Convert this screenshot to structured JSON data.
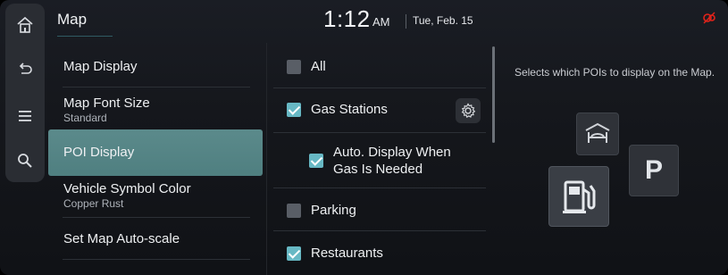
{
  "header": {
    "title": "Map",
    "time": "1:12",
    "ampm": "AM",
    "date": "Tue, Feb. 15"
  },
  "rail": {
    "items": [
      {
        "name": "home-icon"
      },
      {
        "name": "back-icon"
      },
      {
        "name": "menu-icon"
      },
      {
        "name": "search-icon"
      }
    ]
  },
  "menu": {
    "items": [
      {
        "label": "Map Display",
        "sub": ""
      },
      {
        "label": "Map Font Size",
        "sub": "Standard"
      },
      {
        "label": "POI Display",
        "sub": "",
        "selected": true
      },
      {
        "label": "Vehicle Symbol Color",
        "sub": "Copper Rust"
      },
      {
        "label": "Set Map Auto-scale",
        "sub": ""
      }
    ]
  },
  "options": [
    {
      "label": "All",
      "checked": false
    },
    {
      "label": "Gas Stations",
      "checked": true
    },
    {
      "label_line1": "Auto. Display When",
      "label_line2": "Gas Is Needed",
      "checked": true
    },
    {
      "label": "Parking",
      "checked": false
    },
    {
      "label": "Restaurants",
      "checked": true
    }
  ],
  "info": {
    "description": "Selects which POIs to display on the Map."
  },
  "colors": {
    "accent_teal": "#67b8c4",
    "selected_bg": "#5b8a8b",
    "status_red": "#e2231a"
  },
  "illustration": {
    "icons": [
      "lodging-icon",
      "gas-station-icon",
      "parking-icon"
    ],
    "parking_letter": "P"
  }
}
